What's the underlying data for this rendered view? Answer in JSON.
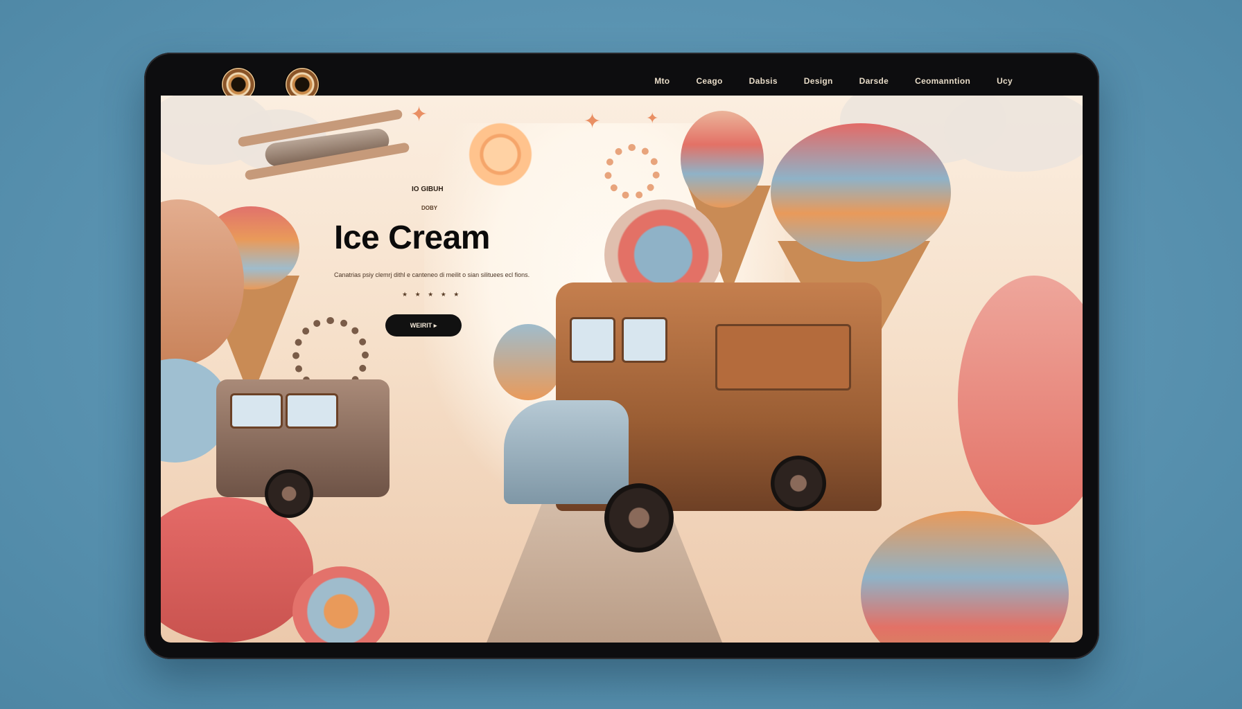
{
  "nav": {
    "logos": [
      "compass-logo-icon",
      "badge-logo-icon"
    ],
    "items": [
      "Mto",
      "Ceago",
      "Dabsis",
      "Design",
      "Darsde",
      "Ceomanntion",
      "Ucy"
    ]
  },
  "hero": {
    "eyebrow": "IO GIBUH",
    "eyebrow_secondary": "DOBY",
    "title": "Ice Cream",
    "description": "Canatrias psiy clemrj dithl e canteneo di meilit o sian silituees ecl fions.",
    "rating": "★ ★ ★ ★ ★",
    "cta_label": "WEIRIT ▸"
  },
  "colors": {
    "background": "#5a93b1",
    "device_frame": "#0d0d0f",
    "accent_pink": "#e3726b",
    "accent_blue": "#8fb2c7",
    "accent_orange": "#e99a5a",
    "cream": "#fbeee0"
  }
}
